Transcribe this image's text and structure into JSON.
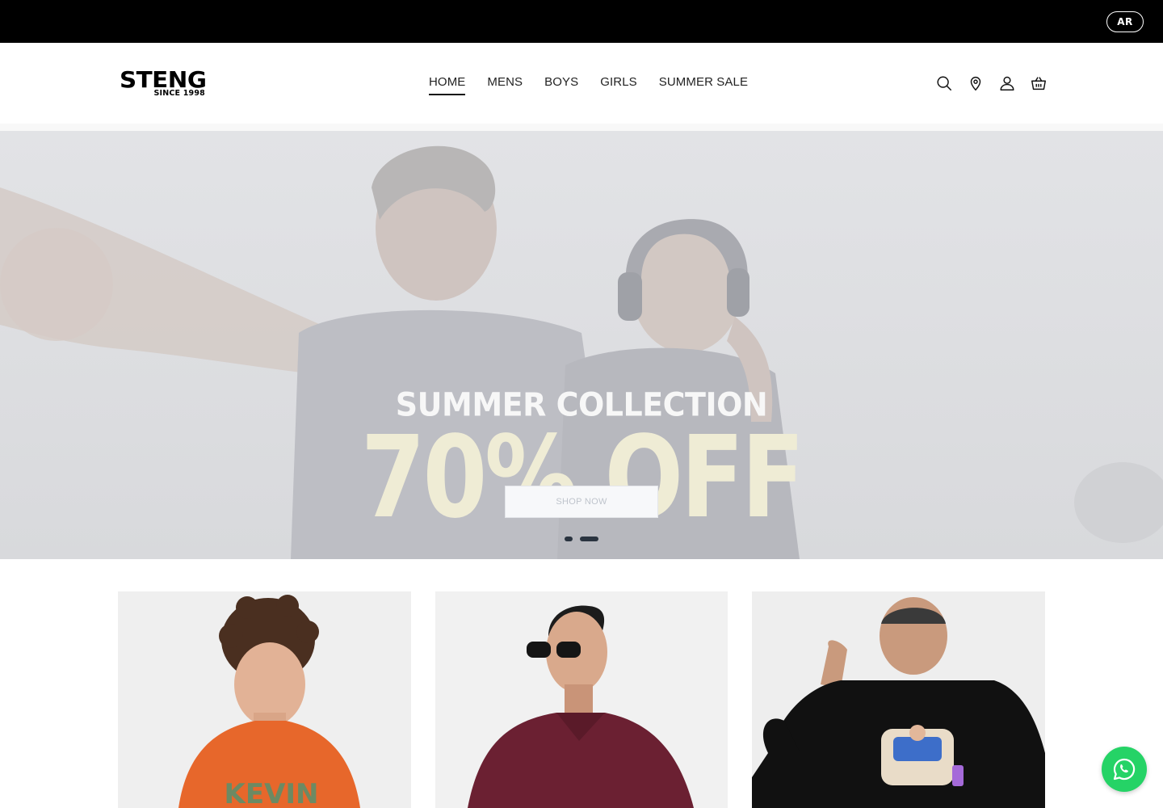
{
  "topbar": {
    "language_label": "AR"
  },
  "header": {
    "logo_main": "STENG",
    "logo_sub": "SINCE 1998",
    "nav": [
      {
        "label": "HOME",
        "active": true
      },
      {
        "label": "MENS"
      },
      {
        "label": "BOYS"
      },
      {
        "label": "GIRLS"
      },
      {
        "label": "SUMMER SALE"
      }
    ],
    "icons": [
      "search-icon",
      "location-icon",
      "account-icon",
      "cart-icon"
    ]
  },
  "hero": {
    "subtitle": "SUMMER COLLECTION",
    "offer": "70% OFF",
    "cta_label": "SHOP NOW",
    "slides_total": 2,
    "active_slide": 2,
    "colors": {
      "background": "#dcdde0",
      "offer": "#efecd5",
      "subtitle": "#f7f7f7"
    }
  },
  "products": [
    {
      "name": "boy-orange-tshirt",
      "print_text": "KEVIN"
    },
    {
      "name": "man-burgundy-polo"
    },
    {
      "name": "man-black-graphic-tshirt"
    }
  ],
  "whatsapp": {
    "icon": "whatsapp-icon",
    "color": "#25d366"
  }
}
